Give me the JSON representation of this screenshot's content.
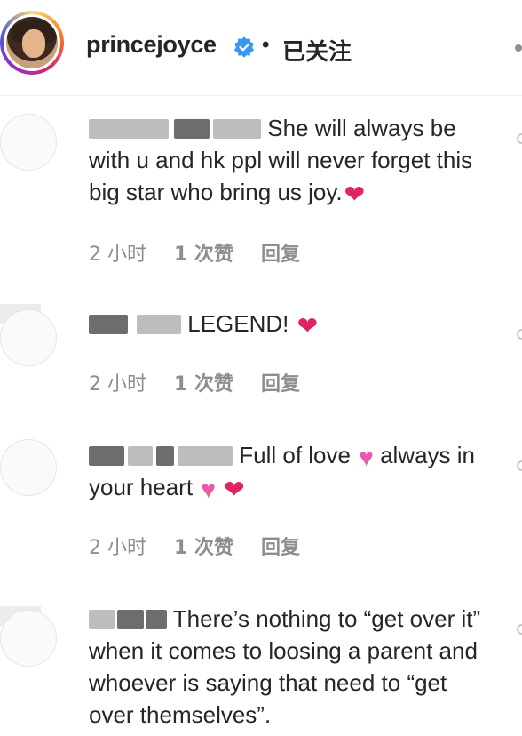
{
  "header": {
    "username": "princejoyce",
    "separator": "•",
    "follow_state": "已关注"
  },
  "comments": [
    {
      "text": "She will always be with u and hk ppl will never forget this big star who bring us joy.",
      "time": "2 小时",
      "likes": "1 次赞",
      "reply": "回复"
    },
    {
      "text": "LEGEND!",
      "time": "2 小时",
      "likes": "1 次赞",
      "reply": "回复"
    },
    {
      "text_a": "Full of love",
      "text_b": "always in your heart",
      "time": "2 小时",
      "likes": "1 次赞",
      "reply": "回复"
    },
    {
      "text": "There’s nothing to “get over it” when it comes to loosing a parent and whoever is saying that need to “get over themselves”."
    }
  ],
  "colors": {
    "text": "#262626",
    "meta": "#8e8e8e",
    "verified_badge": "#3897f0",
    "heart": "#e0245e",
    "pink_heart": "#e85aa8"
  },
  "icons": [
    "verified-badge-icon",
    "heart-icon",
    "pink-heart-icon",
    "like-heart-icon"
  ]
}
